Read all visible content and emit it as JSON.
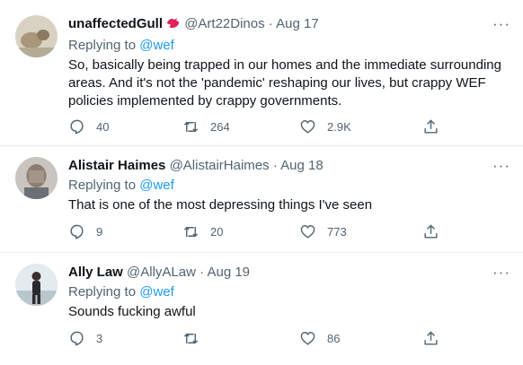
{
  "tweets": [
    {
      "name": "unaffectedGull",
      "handle": "@Art22Dinos",
      "sep": "·",
      "date": "Aug 17",
      "replying_prefix": "Replying to",
      "replying_handle": "@wef",
      "text": "So, basically being trapped in our homes and the immediate surrounding areas. And it's not the 'pandemic' reshaping our lives, but crappy WEF policies implemented by crappy governments.",
      "replies": "40",
      "retweets": "264",
      "likes": "2.9K",
      "more": "···",
      "badge_color": "#e0245e"
    },
    {
      "name": "Alistair Haimes",
      "handle": "@AlistairHaimes",
      "sep": "·",
      "date": "Aug 18",
      "replying_prefix": "Replying to",
      "replying_handle": "@wef",
      "text": "That is one of the most depressing things I've seen",
      "replies": "9",
      "retweets": "20",
      "likes": "773",
      "more": "···"
    },
    {
      "name": "Ally Law",
      "handle": "@AllyALaw",
      "sep": "·",
      "date": "Aug 19",
      "replying_prefix": "Replying to",
      "replying_handle": "@wef",
      "text": "Sounds fucking awful",
      "replies": "3",
      "retweets": "",
      "likes": "86",
      "more": "···"
    }
  ],
  "colors": {
    "link": "#1d9bf0",
    "muted": "#536471",
    "divider": "#e6ecf0"
  }
}
